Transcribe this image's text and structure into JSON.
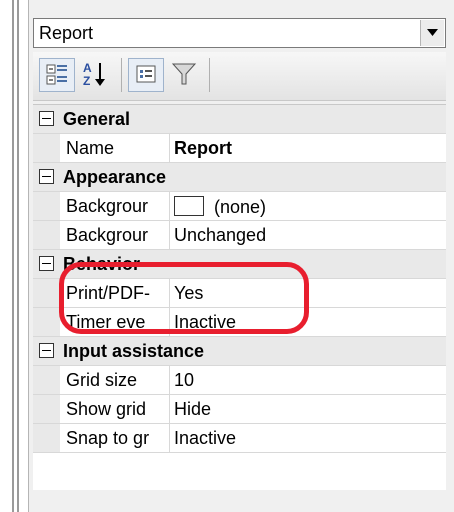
{
  "object_selector": {
    "selected": "Report"
  },
  "toolbar": {
    "buttons": [
      {
        "name": "categorized-button",
        "icon": "categorized-icon",
        "pressed": true
      },
      {
        "name": "alphabetical-button",
        "icon": "sort-az-icon",
        "pressed": false
      },
      {
        "name": "property-pages-button",
        "icon": "property-pages-icon",
        "pressed": true
      },
      {
        "name": "filter-button",
        "icon": "filter-funnel-icon",
        "pressed": false
      }
    ]
  },
  "grid": {
    "categories": [
      {
        "label": "General",
        "properties": [
          {
            "name": "Name",
            "value": "Report",
            "bold": true
          }
        ]
      },
      {
        "label": "Appearance",
        "properties": [
          {
            "name": "Backgrour",
            "value": "(none)",
            "swatch": "#ffffff"
          },
          {
            "name": "Backgrour",
            "value": "Unchanged"
          }
        ]
      },
      {
        "label": "Behavior",
        "properties": [
          {
            "name": "Print/PDF-",
            "value": "Yes"
          },
          {
            "name": "Timer eve",
            "value": "Inactive"
          }
        ]
      },
      {
        "label": "Input assistance",
        "properties": [
          {
            "name": "Grid size",
            "value": "10"
          },
          {
            "name": "Show grid",
            "value": "Hide"
          },
          {
            "name": "Snap to gr",
            "value": "Inactive"
          }
        ]
      }
    ]
  },
  "annotation": {
    "color": "#e81e2e",
    "target": "Behavior"
  }
}
